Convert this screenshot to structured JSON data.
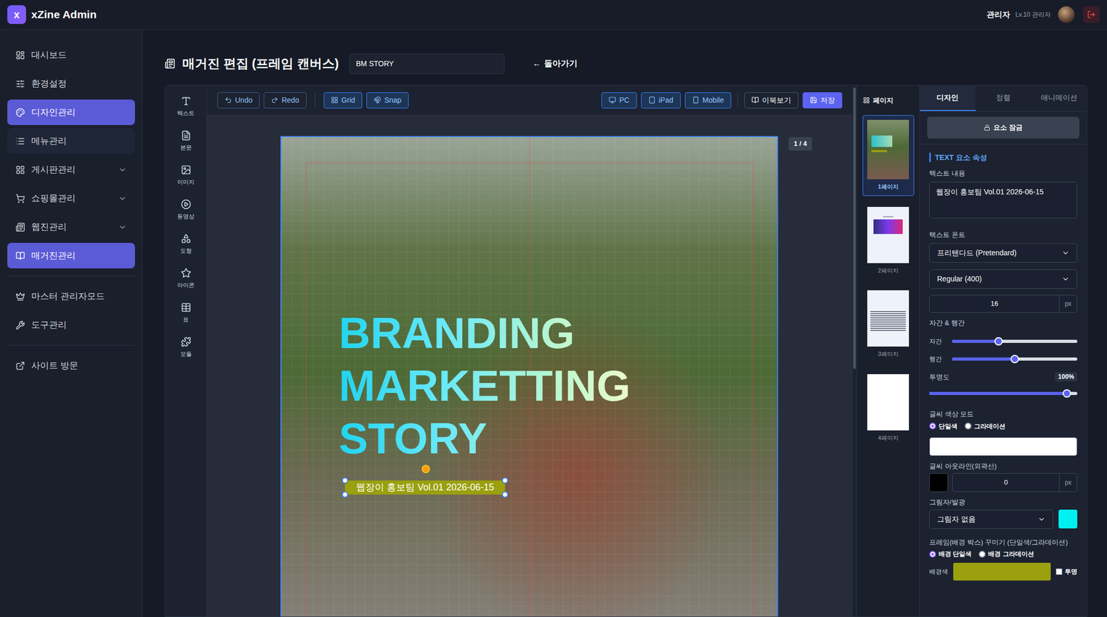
{
  "header": {
    "logo_letter": "x",
    "title": "xZine Admin",
    "user_name": "관리자",
    "user_level": "Lv.10 관리자"
  },
  "sidebar": {
    "sections": [
      [
        {
          "label": "대시보드",
          "selected": false,
          "hovered": false,
          "expandable": false
        },
        {
          "label": "환경설정",
          "selected": false,
          "hovered": false,
          "expandable": false
        },
        {
          "label": "디자인관리",
          "selected": true,
          "hovered": false,
          "expandable": false
        },
        {
          "label": "메뉴관리",
          "selected": false,
          "hovered": true,
          "expandable": false
        },
        {
          "label": "게시판관리",
          "selected": false,
          "hovered": false,
          "expandable": true
        },
        {
          "label": "쇼핑몰관리",
          "selected": false,
          "hovered": false,
          "expandable": true
        },
        {
          "label": "웹진관리",
          "selected": false,
          "hovered": false,
          "expandable": true
        },
        {
          "label": "매거진관리",
          "selected": true,
          "hovered": false,
          "expandable": false
        }
      ],
      [
        {
          "label": "마스터 관리자모드",
          "selected": false,
          "hovered": false,
          "expandable": false
        },
        {
          "label": "도구관리",
          "selected": false,
          "hovered": false,
          "expandable": false
        }
      ],
      [
        {
          "label": "사이트 방문",
          "selected": false,
          "hovered": false,
          "expandable": false
        }
      ]
    ]
  },
  "page": {
    "title": "매거진 편집 (프레임 캔버스)",
    "name_value": "BM STORY",
    "back_arrow": "←",
    "back_label": "돌아가기"
  },
  "tools": [
    "텍스트",
    "본문",
    "이미지",
    "동영상",
    "도형",
    "아이콘",
    "표",
    "모듈"
  ],
  "toolbar": {
    "history": [
      "Undo",
      "Redo"
    ],
    "view": [
      "Grid",
      "Snap"
    ],
    "devices": [
      "PC",
      "iPad",
      "Mobile"
    ],
    "ebook": "이북보기",
    "save": "저장"
  },
  "canvas": {
    "page_counter": "1 / 4",
    "headline": [
      "BRANDING",
      "MARKETTING",
      "STORY"
    ],
    "caption": "웹장이 홍보팀 Vol.01 2026-06-15",
    "caption_selected": true
  },
  "pages": {
    "title": "페이지",
    "items": [
      {
        "label": "1페이지",
        "selected": true,
        "kind": "cover"
      },
      {
        "label": "2페이지",
        "selected": false,
        "kind": "contents"
      },
      {
        "label": "3페이지",
        "selected": false,
        "kind": "article"
      },
      {
        "label": "4페이지",
        "selected": false,
        "kind": "blank"
      }
    ]
  },
  "panel": {
    "tabs": [
      {
        "label": "디자인",
        "selected": true
      },
      {
        "label": "정렬",
        "selected": false
      },
      {
        "label": "애니메이션",
        "selected": false
      }
    ],
    "lock_button": "요소 잠금",
    "section_title": "TEXT 요소 속성",
    "text_content": {
      "label": "텍스트 내용",
      "value": "웹장이 홍보팀 Vol.01 2026-06-15"
    },
    "font": {
      "label": "텍스트 폰트",
      "family": "프리텐다드 (Pretendard)",
      "weight": "Regular (400)",
      "size": "16",
      "unit": "px"
    },
    "spacing": {
      "label": "자간 & 행간",
      "rows": [
        {
          "label": "자간",
          "level": 0.37
        },
        {
          "label": "행간",
          "level": 0.5
        }
      ]
    },
    "opacity": {
      "label": "투명도",
      "reading": "100%",
      "level": 0.93
    },
    "color_mode": {
      "label": "글씨 색상 모드",
      "options": [
        {
          "label": "단일색",
          "selected": true
        },
        {
          "label": "그라데이션",
          "selected": false
        }
      ],
      "color": "#ffffff"
    },
    "outline": {
      "label": "글씨 아웃라인(외곽선)",
      "color": "#000000",
      "width": "0",
      "unit": "px"
    },
    "shadow": {
      "label": "그림자/발광",
      "value": "그림자 없음",
      "color": "#00f0f0"
    },
    "frame": {
      "label": "프레임(배경 박스) 꾸미기 (단일색/그라데이션)",
      "options": [
        {
          "label": "배경 단일색",
          "selected": true
        },
        {
          "label": "배경 그라데이션",
          "selected": false
        }
      ]
    },
    "background": {
      "label": "배경색",
      "color": "#9aa00e",
      "transparent": {
        "label": "투명",
        "checked": false
      }
    }
  }
}
